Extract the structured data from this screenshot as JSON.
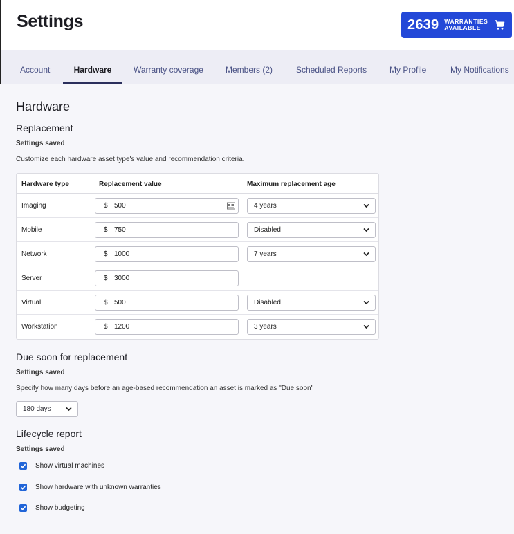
{
  "header": {
    "title": "Settings",
    "warranties_count": "2639",
    "warranties_line1": "WARRANTIES",
    "warranties_line2": "AVAILABLE",
    "accent_color": "#2348d8"
  },
  "tabs": [
    {
      "label": "Account"
    },
    {
      "label": "Hardware",
      "active": true
    },
    {
      "label": "Warranty coverage"
    },
    {
      "label": "Members (2)"
    },
    {
      "label": "Scheduled Reports"
    },
    {
      "label": "My Profile"
    },
    {
      "label": "My Notifications"
    }
  ],
  "main": {
    "heading": "Hardware",
    "replacement": {
      "title": "Replacement",
      "status": "Settings saved",
      "description": "Customize each hardware asset type's value and recommendation criteria.",
      "columns": [
        "Hardware type",
        "Replacement value",
        "Maximum replacement age"
      ],
      "currency_symbol": "$",
      "rows": [
        {
          "type": "Imaging",
          "value": "500",
          "age": "4 years"
        },
        {
          "type": "Mobile",
          "value": "750",
          "age": "Disabled"
        },
        {
          "type": "Network",
          "value": "1000",
          "age": "7 years"
        },
        {
          "type": "Server",
          "value": "3000",
          "age": null
        },
        {
          "type": "Virtual",
          "value": "500",
          "age": "Disabled"
        },
        {
          "type": "Workstation",
          "value": "1200",
          "age": "3 years"
        }
      ]
    },
    "due_soon": {
      "title": "Due soon for replacement",
      "status": "Settings saved",
      "description": "Specify how many days before an age-based recommendation an asset is marked as \"Due soon\"",
      "selected": "180 days"
    },
    "lifecycle": {
      "title": "Lifecycle report",
      "status": "Settings saved",
      "options": [
        {
          "label": "Show virtual machines",
          "checked": true
        },
        {
          "label": "Show hardware with unknown warranties",
          "checked": true
        },
        {
          "label": "Show budgeting",
          "checked": true
        }
      ],
      "checkbox_color": "#2165d8"
    }
  }
}
